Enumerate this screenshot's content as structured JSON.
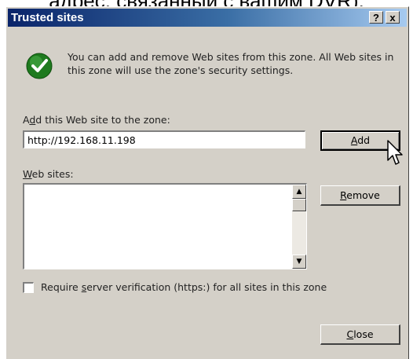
{
  "caption": {
    "text": "адрес, связанный с вашим DVR)."
  },
  "window": {
    "title": "Trusted sites",
    "help_label": "?",
    "close_label": "x"
  },
  "info": {
    "icon": "checkmark-icon",
    "text": "You can add and remove Web sites from this zone. All Web sites in this zone will use the zone's security settings."
  },
  "add_site": {
    "label_prefix": "A",
    "label_mnemonic": "d",
    "label_suffix": "d this Web site to the zone:",
    "value": "http://192.168.11.198",
    "button_mnemonic": "A",
    "button_suffix": "dd"
  },
  "sites": {
    "label_mnemonic": "W",
    "label_suffix": "eb sites:",
    "items": []
  },
  "remove_button": {
    "mnemonic": "R",
    "suffix": "emove"
  },
  "verification": {
    "checked": false,
    "label_prefix": "Require ",
    "label_mnemonic": "s",
    "label_suffix": "erver verification (https:) for all sites in this zone"
  },
  "close_button": {
    "mnemonic": "C",
    "suffix": "lose"
  },
  "colors": {
    "dialog_face": "#d4d0c8",
    "title_start": "#0a246a",
    "title_end": "#a6caf0",
    "icon_green": "#1e7a1e"
  }
}
